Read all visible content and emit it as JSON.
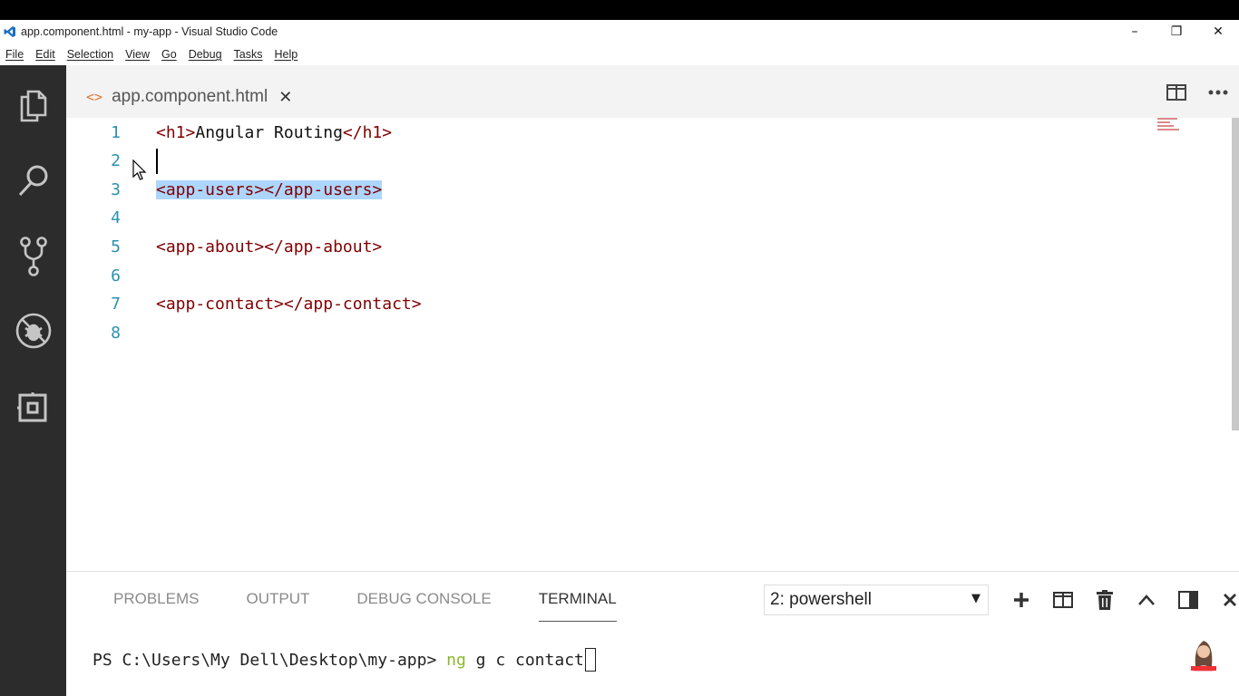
{
  "window": {
    "title": "app.component.html - my-app - Visual Studio Code",
    "controls": {
      "minimize": "–",
      "restore": "❐",
      "close": "✕"
    }
  },
  "menu": [
    "File",
    "Edit",
    "Selection",
    "View",
    "Go",
    "Debug",
    "Tasks",
    "Help"
  ],
  "activitybar": {
    "items": [
      "explorer-icon",
      "search-icon",
      "source-control-icon",
      "debug-icon",
      "extensions-icon"
    ]
  },
  "tab": {
    "icon": "<>",
    "label": "app.component.html",
    "close": "✕"
  },
  "editor": {
    "lines": [
      {
        "n": "1",
        "parts": [
          [
            "tag",
            "<h1>"
          ],
          [
            "txt",
            "Angular Routing"
          ],
          [
            "tag",
            "</h1>"
          ]
        ]
      },
      {
        "n": "2",
        "parts": []
      },
      {
        "n": "3",
        "parts": [
          [
            "tag",
            "<app-users></app-users>"
          ]
        ],
        "selected": true
      },
      {
        "n": "4",
        "parts": []
      },
      {
        "n": "5",
        "parts": [
          [
            "tag",
            "<app-about></app-about>"
          ]
        ]
      },
      {
        "n": "6",
        "parts": []
      },
      {
        "n": "7",
        "parts": [
          [
            "tag",
            "<app-contact></app-contact>"
          ]
        ]
      },
      {
        "n": "8",
        "parts": []
      }
    ]
  },
  "panel": {
    "tabs": [
      "PROBLEMS",
      "OUTPUT",
      "DEBUG CONSOLE",
      "TERMINAL"
    ],
    "active_tab": "TERMINAL",
    "terminal_select": "2: powershell",
    "terminal": {
      "prompt": "PS C:\\Users\\My Dell\\Desktop\\my-app> ",
      "cmd": "ng",
      "args": " g c contact"
    }
  },
  "colors": {
    "activitybar": "#2c2c2c",
    "tag": "#800000",
    "line_number": "#2b91af",
    "selection": "#add6ff",
    "terminal_cmd": "#8ab82c"
  }
}
